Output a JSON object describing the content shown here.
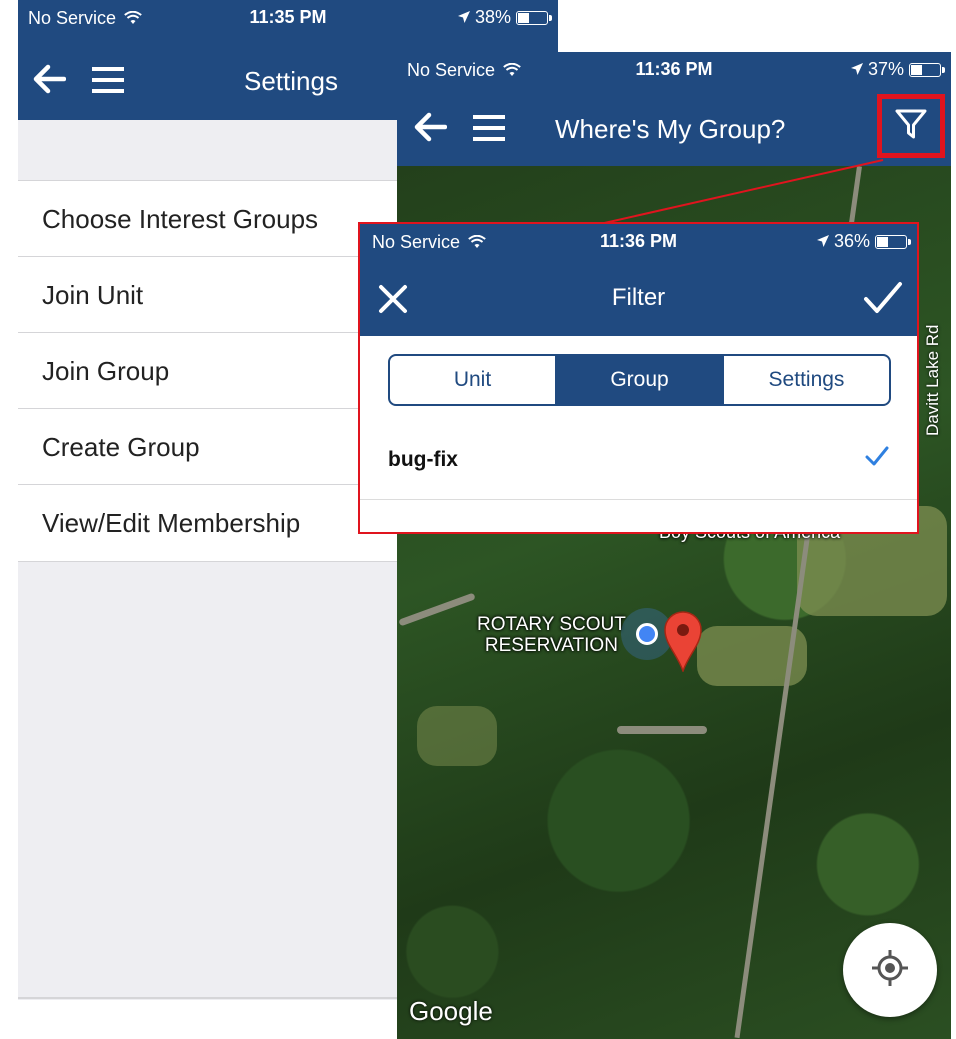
{
  "settings_screen": {
    "status": {
      "carrier": "No Service",
      "time": "11:35 PM",
      "battery": "38%",
      "battery_level": 0.38
    },
    "title": "Settings",
    "items": [
      {
        "label": "Choose Interest Groups"
      },
      {
        "label": "Join Unit"
      },
      {
        "label": "Join Group"
      },
      {
        "label": "Create Group"
      },
      {
        "label": "View/Edit Membership"
      }
    ]
  },
  "map_screen": {
    "status": {
      "carrier": "No Service",
      "time": "11:36 PM",
      "battery": "37%",
      "battery_level": 0.37
    },
    "title": "Where's My Group?",
    "labels": {
      "road": "Davitt Lake Rd",
      "place": "Boy Scouts of America",
      "reservation_line1": "ROTARY SCOUT",
      "reservation_line2": "RESERVATION"
    },
    "attribution": "Google"
  },
  "filter_screen": {
    "status": {
      "carrier": "No Service",
      "time": "11:36 PM",
      "battery": "36%",
      "battery_level": 0.36
    },
    "title": "Filter",
    "tabs": [
      {
        "label": "Unit",
        "active": false
      },
      {
        "label": "Group",
        "active": true
      },
      {
        "label": "Settings",
        "active": false
      }
    ],
    "rows": [
      {
        "label": "bug-fix",
        "checked": true
      }
    ]
  },
  "colors": {
    "navbar": "#204a80",
    "highlight": "#e0141e",
    "check_blue": "#2f80e0",
    "pin_red": "#ea4335"
  }
}
